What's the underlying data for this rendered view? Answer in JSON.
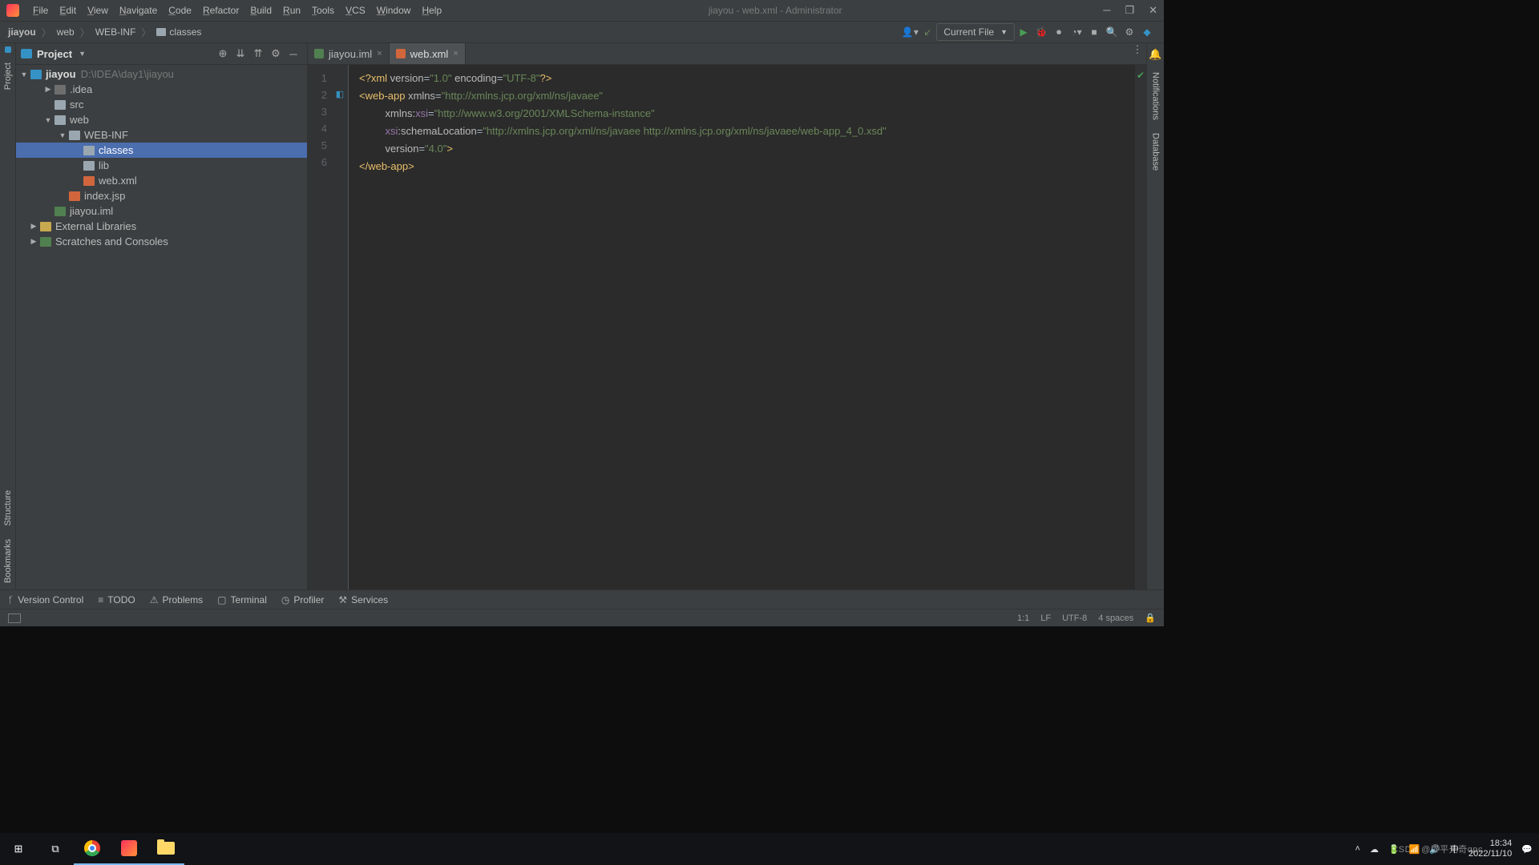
{
  "window": {
    "title": "jiayou - web.xml - Administrator"
  },
  "menu": [
    "File",
    "Edit",
    "View",
    "Navigate",
    "Code",
    "Refactor",
    "Build",
    "Run",
    "Tools",
    "VCS",
    "Window",
    "Help"
  ],
  "breadcrumb": [
    "jiayou",
    "web",
    "WEB-INF",
    "classes"
  ],
  "run_config": "Current File",
  "project_panel": {
    "title": "Project",
    "root": {
      "name": "jiayou",
      "path": "D:\\IDEA\\day1\\jiayou"
    },
    "nodes": [
      {
        "indent": 34,
        "exp": "▶",
        "ico": "t-folder-dark",
        "label": ".idea"
      },
      {
        "indent": 34,
        "exp": "",
        "ico": "t-folder",
        "label": "src"
      },
      {
        "indent": 34,
        "exp": "▼",
        "ico": "t-folder",
        "label": "web"
      },
      {
        "indent": 52,
        "exp": "▼",
        "ico": "t-folder",
        "label": "WEB-INF"
      },
      {
        "indent": 70,
        "exp": "",
        "ico": "t-folder",
        "label": "classes",
        "selected": true
      },
      {
        "indent": 70,
        "exp": "",
        "ico": "t-folder",
        "label": "lib"
      },
      {
        "indent": 70,
        "exp": "",
        "ico": "t-xml",
        "label": "web.xml"
      },
      {
        "indent": 52,
        "exp": "",
        "ico": "t-jsp",
        "label": "index.jsp"
      },
      {
        "indent": 34,
        "exp": "",
        "ico": "t-iml",
        "label": "jiayou.iml"
      },
      {
        "indent": 16,
        "exp": "▶",
        "ico": "t-lib",
        "label": "External Libraries"
      },
      {
        "indent": 16,
        "exp": "▶",
        "ico": "t-scratch",
        "label": "Scratches and Consoles"
      }
    ]
  },
  "tabs": [
    {
      "label": "jiayou.iml",
      "ico": "et-iml",
      "active": false
    },
    {
      "label": "web.xml",
      "ico": "et-xml",
      "active": true
    }
  ],
  "editor": {
    "lines": [
      1,
      2,
      3,
      4,
      5,
      6
    ],
    "l1": {
      "a": "<?xml ",
      "b": "version",
      "c": "=",
      "d": "\"1.0\"",
      "e": " encoding",
      "f": "=",
      "g": "\"UTF-8\"",
      "h": "?>"
    },
    "l2": {
      "a": "<web-app ",
      "b": "xmlns",
      "c": "=",
      "d": "\"http://xmlns.jcp.org/xml/ns/javaee\""
    },
    "l3": {
      "pad": "         ",
      "a": "xmlns:",
      "b": "xsi",
      "c": "=",
      "d": "\"http://www.w3.org/2001/XMLSchema-instance\""
    },
    "l4": {
      "pad": "         ",
      "a": "xsi",
      "b": ":schemaLocation",
      "c": "=",
      "d": "\"http://xmlns.jcp.org/xml/ns/javaee http://xmlns.jcp.org/xml/ns/javaee/web-app_4_0.xsd\""
    },
    "l5": {
      "pad": "         ",
      "a": "version",
      "b": "=",
      "c": "\"4.0\"",
      "d": ">"
    },
    "l6": {
      "a": "</web-app>"
    }
  },
  "left_tools": [
    "Project",
    "Bookmarks",
    "Structure"
  ],
  "right_tools": [
    "Notifications",
    "Database"
  ],
  "bottom_tools": [
    "Version Control",
    "TODO",
    "Problems",
    "Terminal",
    "Profiler",
    "Services"
  ],
  "status": {
    "pos": "1:1",
    "sep": "LF",
    "enc": "UTF-8",
    "indent": "4 spaces"
  },
  "taskbar": {
    "time": "18:34",
    "date": "2022/11/10",
    "watermark": "CSDN @平平无奇qpc"
  }
}
